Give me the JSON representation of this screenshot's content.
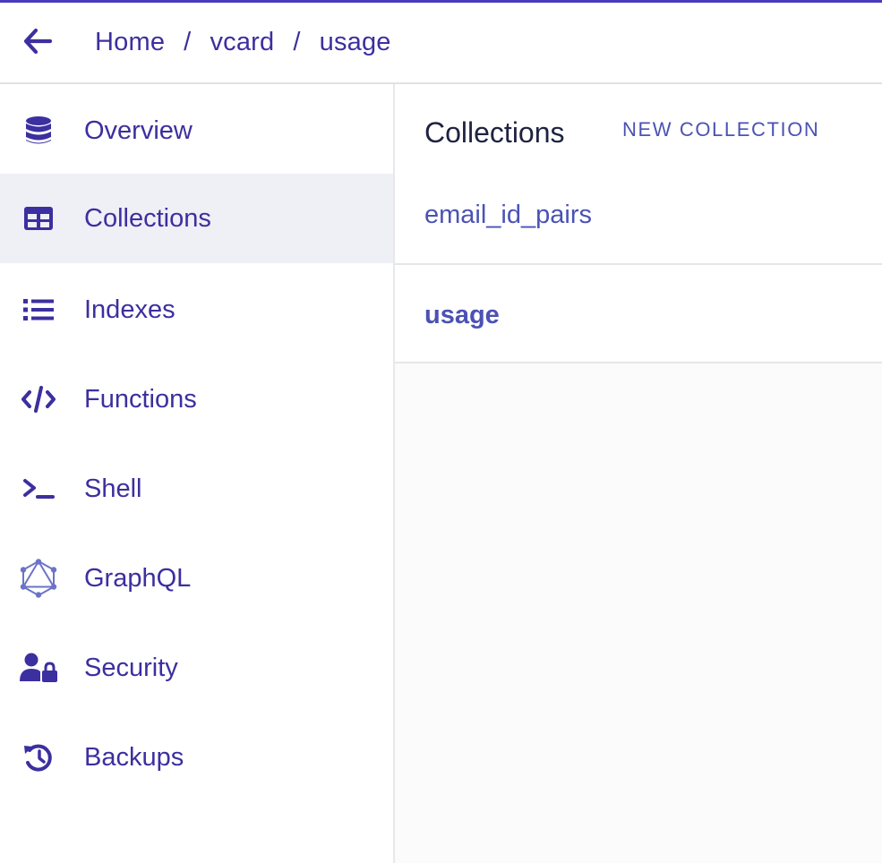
{
  "breadcrumb": {
    "items": [
      "Home",
      "vcard",
      "usage"
    ],
    "separator": "/"
  },
  "sidebar": {
    "items": [
      {
        "label": "Overview",
        "icon": "database-icon"
      },
      {
        "label": "Collections",
        "icon": "table-icon",
        "active": true
      },
      {
        "label": "Indexes",
        "icon": "list-icon"
      },
      {
        "label": "Functions",
        "icon": "code-icon"
      },
      {
        "label": "Shell",
        "icon": "terminal-icon"
      },
      {
        "label": "GraphQL",
        "icon": "graphql-icon"
      },
      {
        "label": "Security",
        "icon": "user-lock-icon"
      },
      {
        "label": "Backups",
        "icon": "history-icon"
      }
    ]
  },
  "collections": {
    "title": "Collections",
    "new_label": "NEW COLLECTION",
    "items": [
      {
        "label": "email_id_pairs",
        "selected": false
      },
      {
        "label": "usage",
        "selected": true
      }
    ]
  },
  "colors": {
    "accent": "#3c2f9f",
    "link": "#4b52b3",
    "active_bg": "#efeff6"
  }
}
